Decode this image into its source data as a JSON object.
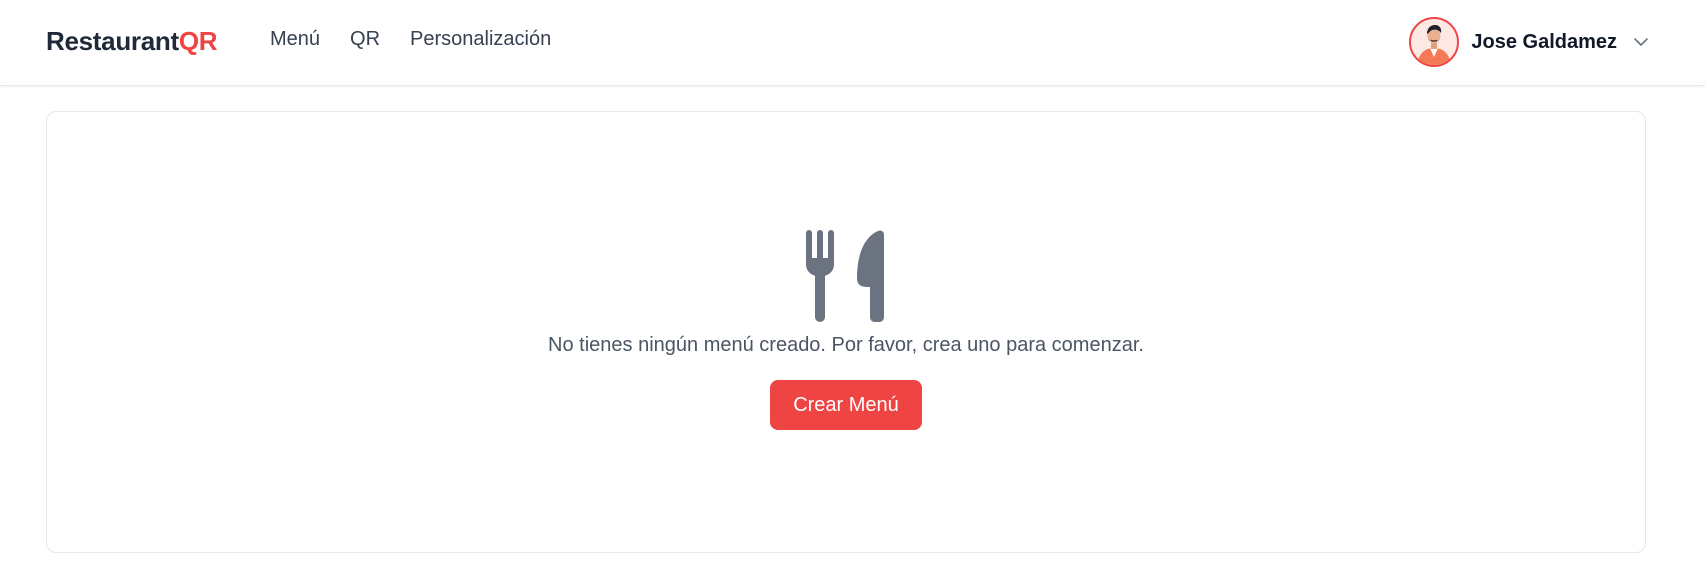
{
  "navbar": {
    "brand_main": "Restaurant",
    "brand_accent": "QR",
    "links": [
      {
        "label": "Menú"
      },
      {
        "label": "QR"
      },
      {
        "label": "Personalización"
      }
    ],
    "user": {
      "name": "Jose Galdamez",
      "avatar_icon": "user-avatar",
      "dropdown_icon": "chevron-down-icon"
    }
  },
  "main": {
    "empty_icon": "utensils-icon",
    "empty_message": "No tienes ningún menú creado. Por favor, crea uno para comenzar.",
    "create_button_label": "Crear Menú"
  },
  "colors": {
    "accent": "#ef4444",
    "icon_gray": "#6b7280",
    "text": "#1f2937",
    "muted_text": "#4b5563",
    "border": "#e5e7eb"
  }
}
